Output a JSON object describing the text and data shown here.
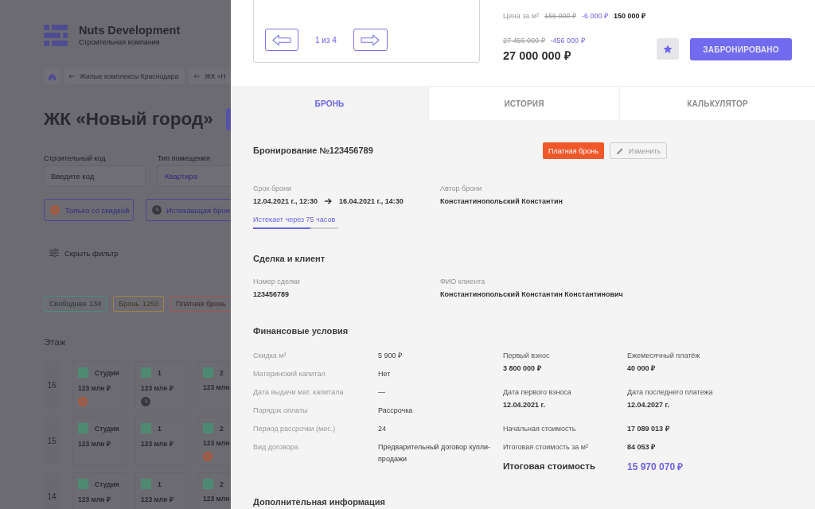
{
  "page": {
    "logo": {
      "name": "Nuts Development",
      "tagline": "Строительная компания"
    },
    "breadcrumbs": [
      {
        "label": "Жилые комплексы Краснодара"
      },
      {
        "label": "ЖК «Н"
      }
    ],
    "title": "ЖК «Новый город»",
    "fields": [
      {
        "label": "Строительный код",
        "placeholder": "Введите код"
      },
      {
        "label": "Тип помещения",
        "value": "Квартира"
      }
    ],
    "toggles": [
      {
        "kind": "discount",
        "label": "Только со скидкой"
      },
      {
        "kind": "expiring",
        "label": "Истекающая брон"
      }
    ],
    "hide_filter": "Скрыть фильтр",
    "status_legend": [
      {
        "label": "Свободная",
        "count": "134",
        "color": "#4e8b7b"
      },
      {
        "label": "Бронь",
        "count": "1250",
        "color": "#9f8249"
      },
      {
        "label": "Платная бронь",
        "color": "#a15656"
      }
    ],
    "floor_heading": "Этаж",
    "floors": [
      {
        "number": "16",
        "units": [
          {
            "kind": "discount",
            "rooms": "Студия",
            "price": "123 млн ₽"
          },
          {
            "kind": "expiring",
            "rooms": "1",
            "price": "123 млн ₽"
          },
          {
            "kind": "plain",
            "rooms": "2",
            "price": "123 млн"
          }
        ]
      },
      {
        "number": "15",
        "units": [
          {
            "kind": "plain",
            "rooms": "Студия",
            "price": "123 млн ₽"
          },
          {
            "kind": "plain",
            "rooms": "1",
            "price": "123 млн ₽"
          },
          {
            "kind": "discount",
            "rooms": "2",
            "price": "123 млн"
          }
        ]
      },
      {
        "number": "14",
        "units": [
          {
            "kind": "plain",
            "rooms": "Студия",
            "price": "123 млн ₽"
          },
          {
            "kind": "plain",
            "rooms": "1",
            "price": "123 млн ₽"
          },
          {
            "kind": "plain",
            "rooms": "2",
            "price": "123 млн"
          }
        ]
      }
    ]
  },
  "drawer": {
    "gallery": {
      "counter": "1 из 4"
    },
    "price_per_m2": {
      "label": "Цена за м²",
      "old": "156 000 ₽",
      "discount": "-6 000 ₽",
      "current": "150 000 ₽"
    },
    "price": {
      "old": "27 456 000 ₽",
      "discount": "-456 000 ₽",
      "current": "27 000 000 ₽"
    },
    "book_button": "ЗАБРОНИРОВАНО",
    "tabs": [
      {
        "label": "БРОНЬ",
        "selected": true
      },
      {
        "label": "ИСТОРИЯ",
        "selected": false
      },
      {
        "label": "КАЛЬКУЛЯТОР",
        "selected": false
      }
    ],
    "booking": {
      "title": "Бронирование №123456789",
      "status": "Платная бронь",
      "edit_button": "Изменить",
      "period": {
        "label": "Срок брони",
        "start": "12.04.2021 г., 12:30",
        "end": "16.04.2021 г., 14:30"
      },
      "author": {
        "label": "Автор брони",
        "value": "Константинопольский Константин"
      },
      "expiry": {
        "label": "Истекает через 75 часов",
        "level": 0.67
      }
    },
    "deal": {
      "title": "Сделка и клиент",
      "fields": [
        {
          "label": "Номер сделки",
          "value": "123456789"
        },
        {
          "label": "ФИО клиента",
          "value": "Константинопольский Константин Константинович"
        }
      ]
    },
    "finance": {
      "title": "Финансовые условия",
      "terms": [
        {
          "label": "Скидка м²",
          "value": "5 900 ₽"
        },
        {
          "label": "Материнский капитал",
          "value": "Нет"
        },
        {
          "label": "Дата выдачи мат. капитала",
          "value": "—"
        },
        {
          "label": "Порядок оплаты",
          "value": "Рассрочка"
        },
        {
          "label": "Период рассрочки (мес.)",
          "value": "24"
        },
        {
          "label": "Вид договора",
          "value": "Предварительный договор купли-продажи"
        }
      ],
      "payments": [
        {
          "label": "Первый взнос",
          "value": "3 800 000 ₽"
        },
        {
          "label": "Ежемесячный платёж",
          "value": "40 000 ₽"
        },
        {
          "label": "Дата первого взноса",
          "value": "12.04.2021 г."
        },
        {
          "label": "Дата последнего платежа",
          "value": "12.04.2027 г."
        }
      ],
      "costs": [
        {
          "label": "Начальная стоимость",
          "value": "17 089 013 ₽"
        },
        {
          "label": "Итоговая стоимость за м²",
          "value": "84 053 ₽"
        }
      ],
      "total": {
        "label": "Итоговая стоимость",
        "value": "15 970 070 ₽"
      }
    },
    "additional": {
      "title": "Дополнительная информация"
    }
  }
}
